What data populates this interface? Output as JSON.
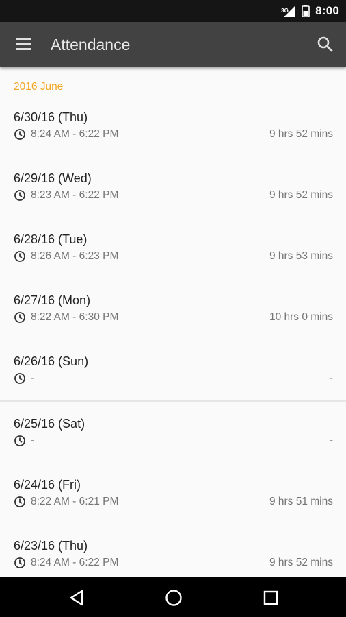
{
  "status_bar": {
    "network": "3G",
    "time": "8:00"
  },
  "app_bar": {
    "title": "Attendance",
    "menu_icon": "hamburger-menu-icon",
    "search_icon": "search-icon"
  },
  "colors": {
    "app_bar": "#424242",
    "status_bar": "#151515",
    "accent": "#f5a623",
    "background": "#fafafa"
  },
  "section": {
    "header": "2016 June"
  },
  "entries": [
    {
      "date": "6/30/16 (Thu)",
      "time": "8:24 AM - 6:22 PM",
      "duration": "9 hrs 52 mins"
    },
    {
      "date": "6/29/16 (Wed)",
      "time": "8:23 AM - 6:22 PM",
      "duration": "9 hrs 52 mins"
    },
    {
      "date": "6/28/16 (Tue)",
      "time": "8:26 AM - 6:23 PM",
      "duration": "9 hrs 53 mins"
    },
    {
      "date": "6/27/16 (Mon)",
      "time": "8:22 AM - 6:30 PM",
      "duration": "10 hrs 0 mins"
    },
    {
      "date": "6/26/16 (Sun)",
      "time": "-",
      "duration": "-"
    },
    {
      "date": "6/25/16 (Sat)",
      "time": "-",
      "duration": "-"
    },
    {
      "date": "6/24/16 (Fri)",
      "time": "8:22 AM - 6:21 PM",
      "duration": "9 hrs 51 mins"
    },
    {
      "date": "6/23/16 (Thu)",
      "time": "8:24 AM - 6:22 PM",
      "duration": "9 hrs 52 mins"
    }
  ],
  "nav_bar": {
    "back_icon": "back-triangle-icon",
    "home_icon": "home-circle-icon",
    "recents_icon": "recents-square-icon"
  }
}
